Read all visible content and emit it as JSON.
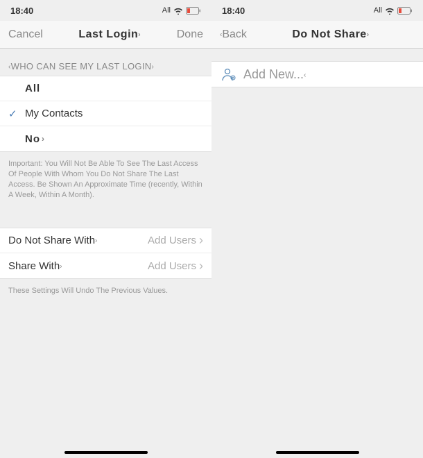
{
  "left": {
    "status": {
      "time": "18:40",
      "carrier": "All"
    },
    "nav": {
      "back": "Cancel",
      "title": "Last Login",
      "done": "Done"
    },
    "section_header": "WHO CAN SEE MY LAST LOGIN",
    "options": {
      "all": "All",
      "my_contacts": "My Contacts",
      "no": "No"
    },
    "important_note": "Important: You Will Not Be Able To See The Last Access Of People With Whom You Do Not Share The Last Access. Be Shown An Approximate Time (recently, Within A Week, Within A Month).",
    "share_rows": {
      "do_not_share": {
        "label": "Do Not Share With",
        "action": "Add Users"
      },
      "share": {
        "label": "Share With",
        "action": "Add Users"
      }
    },
    "settings_note": "These Settings Will Undo The Previous Values."
  },
  "right": {
    "status": {
      "time": "18:40",
      "carrier": "All"
    },
    "nav": {
      "back": "Back",
      "title": "Do Not Share"
    },
    "add_new": "Add New..."
  }
}
